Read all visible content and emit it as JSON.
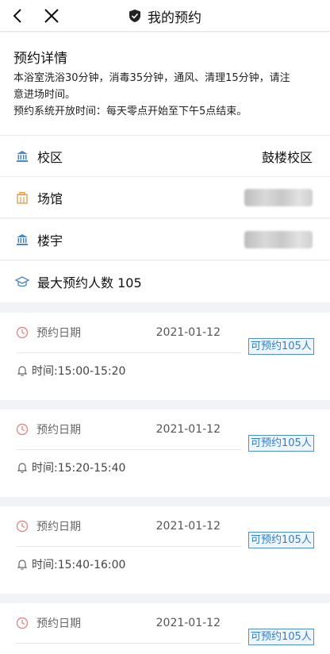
{
  "header": {
    "title": "我的预约"
  },
  "info": {
    "title": "预约详情",
    "line1": "本浴室洗浴30分钟，消毒35分钟，通风、清理15分钟，请注",
    "line2": "意进场时间。",
    "line3": "预约系统开放时间：每天零点开始至下午5点结束。"
  },
  "fields": {
    "campus_label": "校区",
    "campus_value": "鼓楼校区",
    "venue_label": "场馆",
    "building_label": "楼宇",
    "max_label": "最大预约人数 105"
  },
  "slots": [
    {
      "date_label": "预约日期",
      "date": "2021-01-12",
      "badge": "可预约105人",
      "time": "时间:15:00-15:20"
    },
    {
      "date_label": "预约日期",
      "date": "2021-01-12",
      "badge": "可预约105人",
      "time": "时间:15:20-15:40"
    },
    {
      "date_label": "预约日期",
      "date": "2021-01-12",
      "badge": "可预约105人",
      "time": "时间:15:40-16:00"
    },
    {
      "date_label": "预约日期",
      "date": "2021-01-12",
      "badge": "可预约105人",
      "time": ""
    }
  ],
  "colors": {
    "accent": "#2f7fc9",
    "clock": "#e08b8b",
    "campus_icon": "#4a86c8",
    "venue_icon": "#e0a050"
  }
}
